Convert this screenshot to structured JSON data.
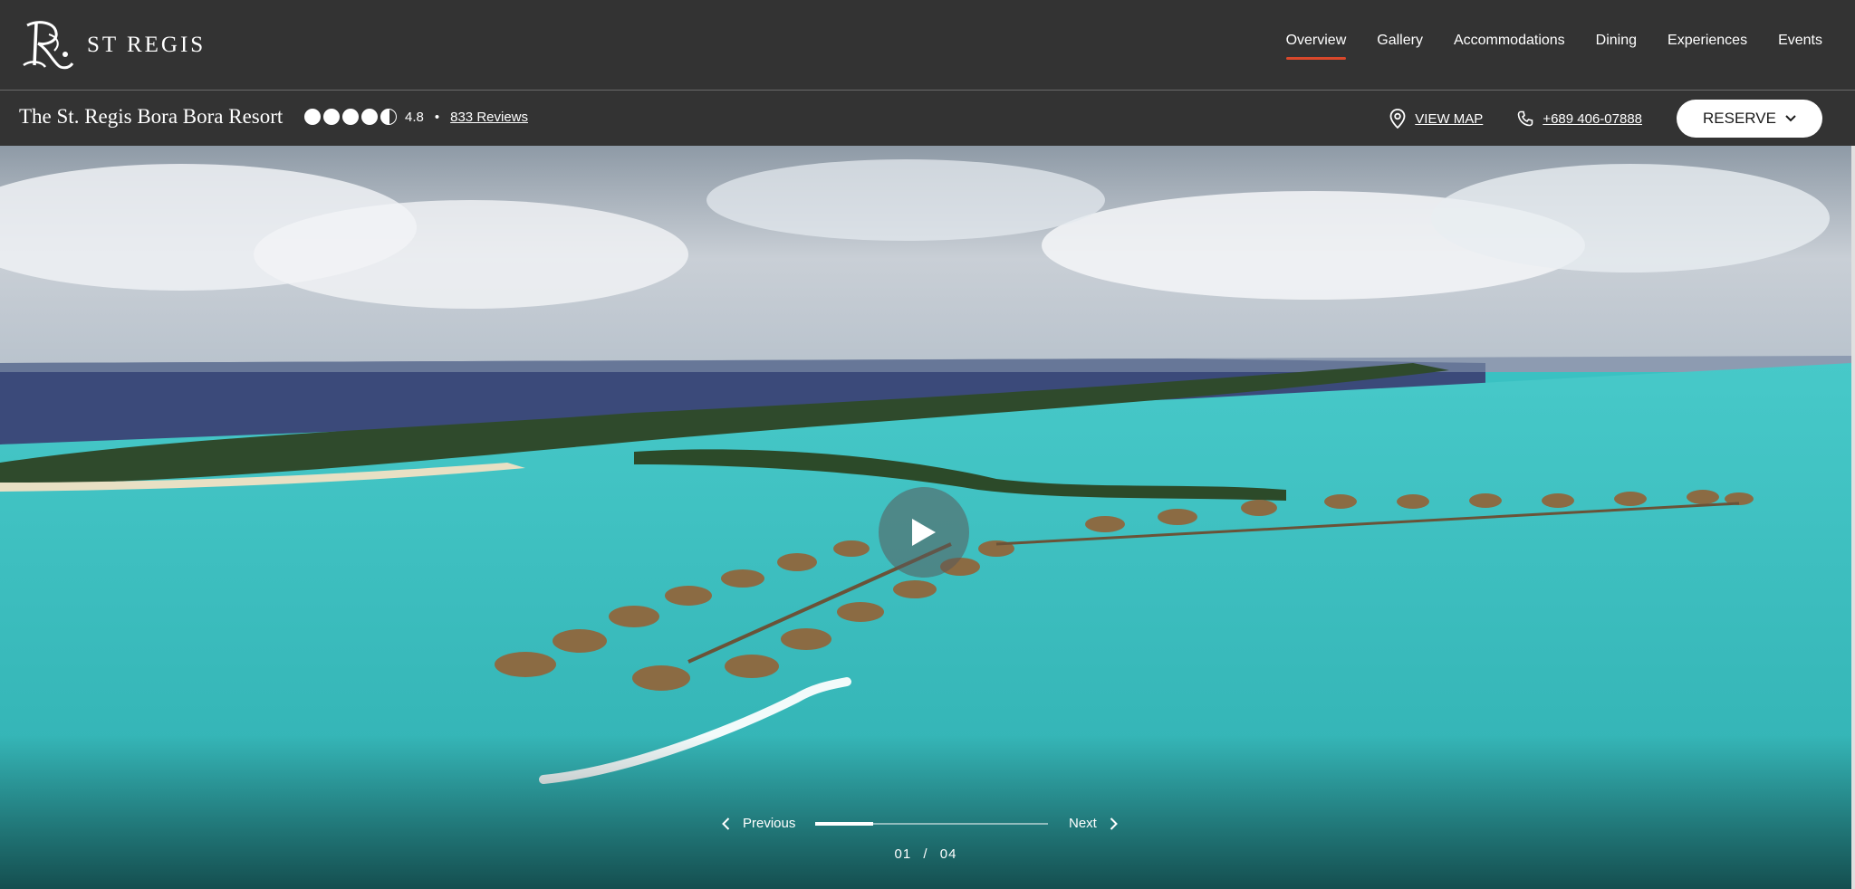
{
  "brand": {
    "name": "ST REGIS",
    "logo_icon": "st-regis-monogram"
  },
  "nav": {
    "items": [
      {
        "label": "Overview",
        "active": true
      },
      {
        "label": "Gallery",
        "active": false
      },
      {
        "label": "Accommodations",
        "active": false
      },
      {
        "label": "Dining",
        "active": false
      },
      {
        "label": "Experiences",
        "active": false
      },
      {
        "label": "Events",
        "active": false
      }
    ],
    "active_underline_color": "#d9482b"
  },
  "property": {
    "title": "The St. Regis Bora Bora Resort",
    "rating": 4.8,
    "rating_max": 5,
    "rating_label": "4.8",
    "separator": "•",
    "reviews_label": "833 Reviews",
    "map_label": "VIEW MAP",
    "phone_label": "+689 406-07888",
    "reserve_label": "RESERVE"
  },
  "hero": {
    "media": "aerial-video-overwater-bungalows",
    "play_icon": "play-icon",
    "carousel": {
      "prev_label": "Previous",
      "next_label": "Next",
      "current": "01",
      "separator": "/",
      "total": "04",
      "progress": 0.25
    }
  },
  "colors": {
    "bar_bg": "#333333",
    "lagoon": "#3ac1c2",
    "accent": "#d9482b"
  }
}
